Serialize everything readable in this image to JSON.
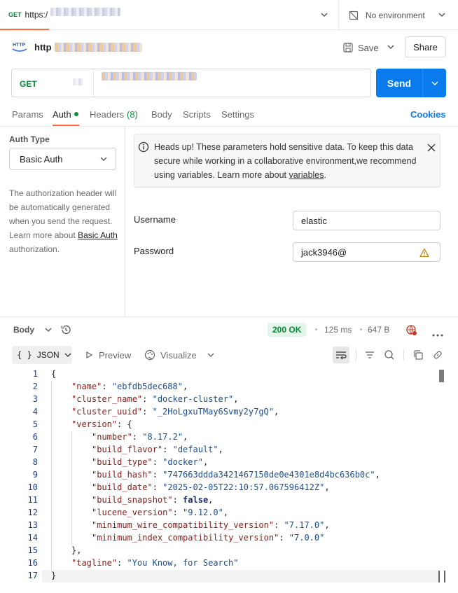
{
  "tabbar": {
    "method": "GET",
    "url_prefix": "https:/",
    "environment": "No environment"
  },
  "request_header": {
    "name_prefix": "http",
    "save_label": "Save",
    "share_label": "Share"
  },
  "url_bar": {
    "method": "GET",
    "send_label": "Send"
  },
  "tabs": {
    "params": "Params",
    "auth": "Auth",
    "headers": "Headers",
    "headers_count": "(8)",
    "body": "Body",
    "scripts": "Scripts",
    "settings": "Settings",
    "cookies": "Cookies"
  },
  "auth": {
    "type_label": "Auth Type",
    "type_value": "Basic Auth",
    "desc_text": "The authorization header will be automatically generated when you send the request. Learn more about ",
    "desc_link": "Basic Auth",
    "desc_tail": " authorization.",
    "notice_text": "Heads up! These parameters hold sensitive data. To keep this data secure while working in a collaborative environment,we recommend using variables. Learn more about ",
    "notice_link": "variables",
    "notice_tail": ".",
    "username_label": "Username",
    "username_value": "elastic",
    "password_label": "Password",
    "password_value": "jack3946@"
  },
  "response": {
    "body_label": "Body",
    "status": "200 OK",
    "time": "125 ms",
    "size": "647 B",
    "format": "JSON",
    "preview_label": "Preview",
    "visualize_label": "Visualize"
  },
  "code_lines": [
    {
      "n": "1",
      "indent": 0,
      "parts": [
        [
          "p",
          "{"
        ]
      ]
    },
    {
      "n": "2",
      "indent": 1,
      "parts": [
        [
          "k",
          "\"name\""
        ],
        [
          "p",
          ": "
        ],
        [
          "s",
          "\"ebfdb5dec688\""
        ],
        [
          "p",
          ","
        ]
      ]
    },
    {
      "n": "3",
      "indent": 1,
      "parts": [
        [
          "k",
          "\"cluster_name\""
        ],
        [
          "p",
          ": "
        ],
        [
          "s",
          "\"docker-cluster\""
        ],
        [
          "p",
          ","
        ]
      ]
    },
    {
      "n": "4",
      "indent": 1,
      "parts": [
        [
          "k",
          "\"cluster_uuid\""
        ],
        [
          "p",
          ": "
        ],
        [
          "s",
          "\"_2HoLgxuTMay6Svmy2y7gQ\""
        ],
        [
          "p",
          ","
        ]
      ]
    },
    {
      "n": "5",
      "indent": 1,
      "parts": [
        [
          "k",
          "\"version\""
        ],
        [
          "p",
          ": {"
        ]
      ]
    },
    {
      "n": "6",
      "indent": 2,
      "parts": [
        [
          "k",
          "\"number\""
        ],
        [
          "p",
          ": "
        ],
        [
          "s",
          "\"8.17.2\""
        ],
        [
          "p",
          ","
        ]
      ]
    },
    {
      "n": "7",
      "indent": 2,
      "parts": [
        [
          "k",
          "\"build_flavor\""
        ],
        [
          "p",
          ": "
        ],
        [
          "s",
          "\"default\""
        ],
        [
          "p",
          ","
        ]
      ]
    },
    {
      "n": "8",
      "indent": 2,
      "parts": [
        [
          "k",
          "\"build_type\""
        ],
        [
          "p",
          ": "
        ],
        [
          "s",
          "\"docker\""
        ],
        [
          "p",
          ","
        ]
      ]
    },
    {
      "n": "9",
      "indent": 2,
      "parts": [
        [
          "k",
          "\"build_hash\""
        ],
        [
          "p",
          ": "
        ],
        [
          "s",
          "\"747663ddda3421467150de0e4301e8d4bc636b0c\""
        ],
        [
          "p",
          ","
        ]
      ]
    },
    {
      "n": "10",
      "indent": 2,
      "parts": [
        [
          "k",
          "\"build_date\""
        ],
        [
          "p",
          ": "
        ],
        [
          "s",
          "\"2025-02-05T22:10:57.067596412Z\""
        ],
        [
          "p",
          ","
        ]
      ]
    },
    {
      "n": "11",
      "indent": 2,
      "parts": [
        [
          "k",
          "\"build_snapshot\""
        ],
        [
          "p",
          ": "
        ],
        [
          "b",
          "false"
        ],
        [
          "p",
          ","
        ]
      ]
    },
    {
      "n": "12",
      "indent": 2,
      "parts": [
        [
          "k",
          "\"lucene_version\""
        ],
        [
          "p",
          ": "
        ],
        [
          "s",
          "\"9.12.0\""
        ],
        [
          "p",
          ","
        ]
      ]
    },
    {
      "n": "13",
      "indent": 2,
      "parts": [
        [
          "k",
          "\"minimum_wire_compatibility_version\""
        ],
        [
          "p",
          ": "
        ],
        [
          "s",
          "\"7.17.0\""
        ],
        [
          "p",
          ","
        ]
      ]
    },
    {
      "n": "14",
      "indent": 2,
      "parts": [
        [
          "k",
          "\"minimum_index_compatibility_version\""
        ],
        [
          "p",
          ": "
        ],
        [
          "s",
          "\"7.0.0\""
        ]
      ]
    },
    {
      "n": "15",
      "indent": 1,
      "parts": [
        [
          "p",
          "},"
        ]
      ]
    },
    {
      "n": "16",
      "indent": 1,
      "parts": [
        [
          "k",
          "\"tagline\""
        ],
        [
          "p",
          ": "
        ],
        [
          "s",
          "\"You Know, for Search\""
        ]
      ]
    },
    {
      "n": "17",
      "indent": 0,
      "parts": [
        [
          "p",
          "}"
        ]
      ]
    }
  ],
  "colors": {
    "accent": "#ff6c37",
    "send": "#097bed",
    "status_ok": "#0b8a3a",
    "status_bg": "#e3f6e9"
  }
}
